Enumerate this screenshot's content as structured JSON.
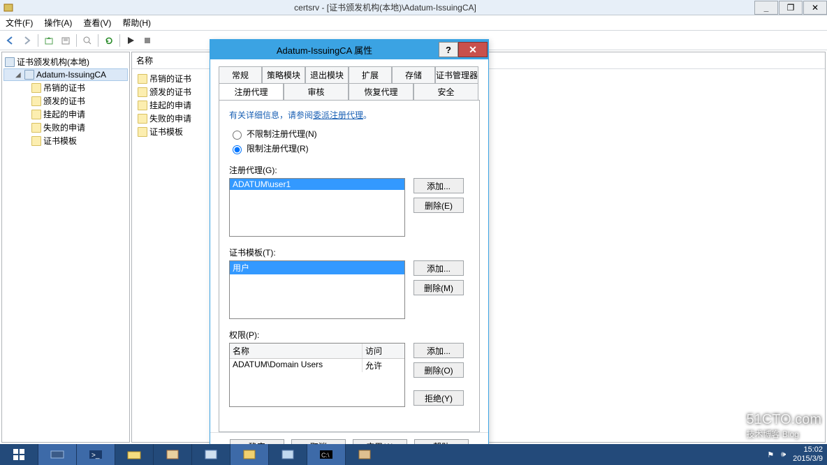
{
  "titlebar": {
    "text": "certsrv - [证书颁发机构(本地)\\Adatum-IssuingCA]"
  },
  "menu": {
    "file": "文件(F)",
    "action": "操作(A)",
    "view": "查看(V)",
    "help": "帮助(H)"
  },
  "tree": {
    "root": "证书颁发机构(本地)",
    "ca": "Adatum-IssuingCA",
    "folders": [
      "吊销的证书",
      "颁发的证书",
      "挂起的申请",
      "失败的申请",
      "证书模板"
    ]
  },
  "detail_header": "名称",
  "dialog": {
    "title": "Adatum-IssuingCA 属性",
    "tabs_top": [
      "常规",
      "策略模块",
      "退出模块",
      "扩展",
      "存储",
      "证书管理器"
    ],
    "tabs_bot": [
      "注册代理",
      "审核",
      "恢复代理",
      "安全"
    ],
    "hint_prefix": "有关详细信息，请参阅",
    "hint_link": "委派注册代理",
    "hint_suffix": "。",
    "radio_unrestricted": "不限制注册代理(N)",
    "radio_restricted": "限制注册代理(R)",
    "agents_label": "注册代理(G):",
    "agents": [
      "ADATUM\\user1"
    ],
    "templates_label": "证书模板(T):",
    "templates": [
      "用户"
    ],
    "perms_label": "权限(P):",
    "perm_col_name": "名称",
    "perm_col_access": "访问",
    "perm_rows": [
      {
        "name": "ADATUM\\Domain Users",
        "access": "允许"
      }
    ],
    "btn_add": "添加...",
    "btn_del_e": "删除(E)",
    "btn_del_m": "删除(M)",
    "btn_del_o": "删除(O)",
    "btn_deny": "拒绝(Y)",
    "btn_ok": "确定",
    "btn_cancel": "取消",
    "btn_apply": "应用(A)",
    "btn_help": "帮助"
  },
  "tray": {
    "time": "15:02",
    "date": "2015/3/9"
  },
  "watermark": {
    "site": "51CTO.com",
    "sub": "技术博客  Blog"
  }
}
